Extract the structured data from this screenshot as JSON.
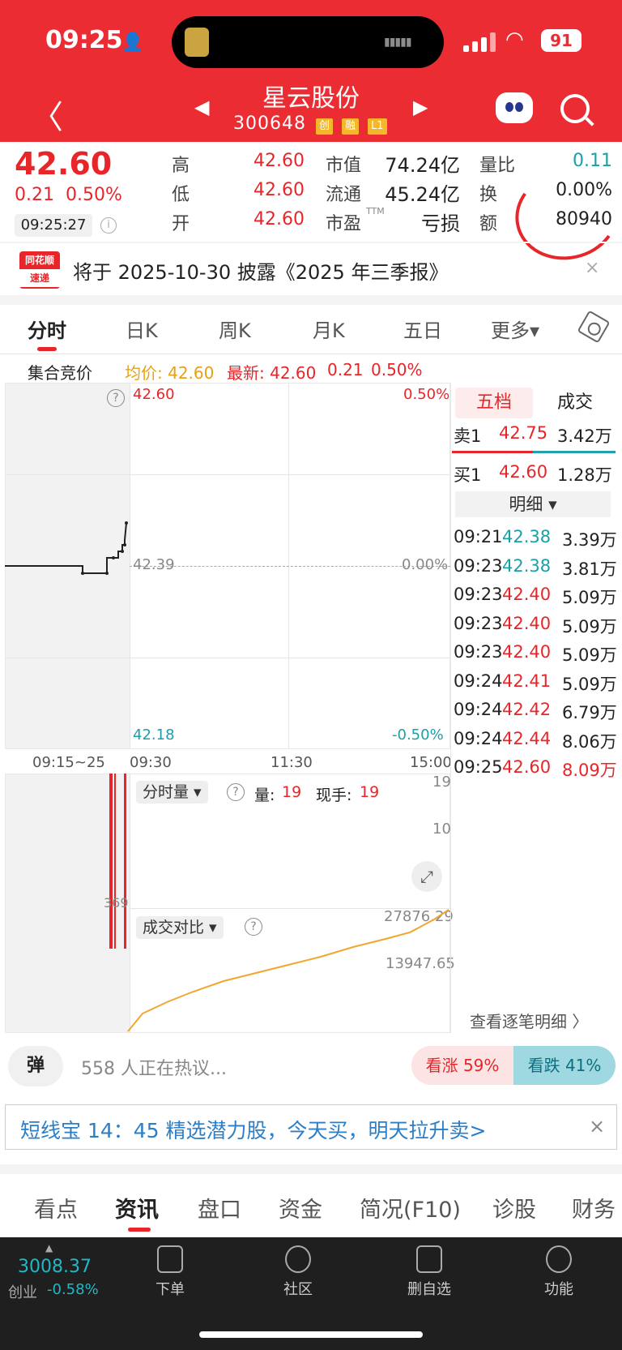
{
  "status": {
    "time": "09:25",
    "battery": "91"
  },
  "header": {
    "title": "星云股份",
    "code": "300648",
    "tags": [
      "创",
      "融",
      "L1"
    ]
  },
  "quote": {
    "price": "42.60",
    "change": "0.21",
    "change_pct": "0.50%",
    "time": "09:25:27",
    "high_label": "高",
    "high": "42.60",
    "low_label": "低",
    "low": "42.60",
    "open_label": "开",
    "open": "42.60",
    "mktcap_label": "市值",
    "mktcap": "74.24亿",
    "float_label": "流通",
    "float": "45.24亿",
    "pe_label": "市盈",
    "pe_sup": "TTM",
    "pe": "亏损",
    "volratio_label": "量比",
    "volratio": "0.11",
    "turnover_label": "换",
    "turnover": "0.00%",
    "amount_label": "额",
    "amount": "80940"
  },
  "news": {
    "logo_top": "同花顺",
    "logo_bottom": "速递",
    "text": "将于 2025-10-30 披露《2025 年三季报》",
    "close": "×"
  },
  "tabs": [
    "分时",
    "日K",
    "周K",
    "月K",
    "五日",
    "更多▾"
  ],
  "auction": {
    "label": "集合竞价",
    "avg": "均价: 42.60",
    "latest": "最新: 42.60",
    "chg": "0.21",
    "pct": "0.50%"
  },
  "chart": {
    "top_price": "42.60",
    "top_pct": "0.50%",
    "mid_price": "42.39",
    "mid_pct": "0.00%",
    "bottom_price": "42.18",
    "bottom_pct": "-0.50%",
    "x_labels": [
      "09:15~25",
      "09:30",
      "11:30",
      "15:00"
    ]
  },
  "volume": {
    "selector": "分时量 ▾",
    "vol_label": "量:",
    "vol": "19",
    "hand_label": "现手:",
    "hand": "19",
    "y_top": "19",
    "y_mid": "10",
    "left_val": "369",
    "compare": "成交对比 ▾",
    "cmp_top": "27876.29",
    "cmp_mid": "13947.65"
  },
  "orderbook": {
    "tab_active": "五档",
    "tab_other": "成交",
    "sell1": {
      "label": "卖1",
      "price": "42.75",
      "vol": "3.42万"
    },
    "buy1": {
      "label": "买1",
      "price": "42.60",
      "vol": "1.28万"
    },
    "detail_label": "明细 ▾",
    "ticks": [
      {
        "t": "09:21",
        "p": "42.38",
        "v": "3.39万",
        "c": "green"
      },
      {
        "t": "09:23",
        "p": "42.38",
        "v": "3.81万",
        "c": "green"
      },
      {
        "t": "09:23",
        "p": "42.40",
        "v": "5.09万",
        "c": "red"
      },
      {
        "t": "09:23",
        "p": "42.40",
        "v": "5.09万",
        "c": "red"
      },
      {
        "t": "09:23",
        "p": "42.40",
        "v": "5.09万",
        "c": "red"
      },
      {
        "t": "09:24",
        "p": "42.41",
        "v": "5.09万",
        "c": "red"
      },
      {
        "t": "09:24",
        "p": "42.42",
        "v": "6.79万",
        "c": "red"
      },
      {
        "t": "09:24",
        "p": "42.44",
        "v": "8.06万",
        "c": "red"
      },
      {
        "t": "09:25",
        "p": "42.60",
        "v": "8.09万",
        "c": "red"
      }
    ],
    "more": "查看逐笔明细 〉"
  },
  "social": {
    "danmu": "弹",
    "hot": "558 人正在热议...",
    "up": "看涨 59%",
    "down": "看跌 41%"
  },
  "promo": {
    "text": "短线宝 14：45 精选潜力股，今天买，明天拉升卖>",
    "close": "×"
  },
  "bottom_tabs": [
    "看点",
    "资讯",
    "盘口",
    "资金",
    "简况(F10)",
    "诊股",
    "财务"
  ],
  "bottom_bar": {
    "index_value": "3008.37",
    "index_name": "创业",
    "index_chg": "-0.58%",
    "items": [
      "下单",
      "社区",
      "删自选",
      "功能"
    ]
  }
}
